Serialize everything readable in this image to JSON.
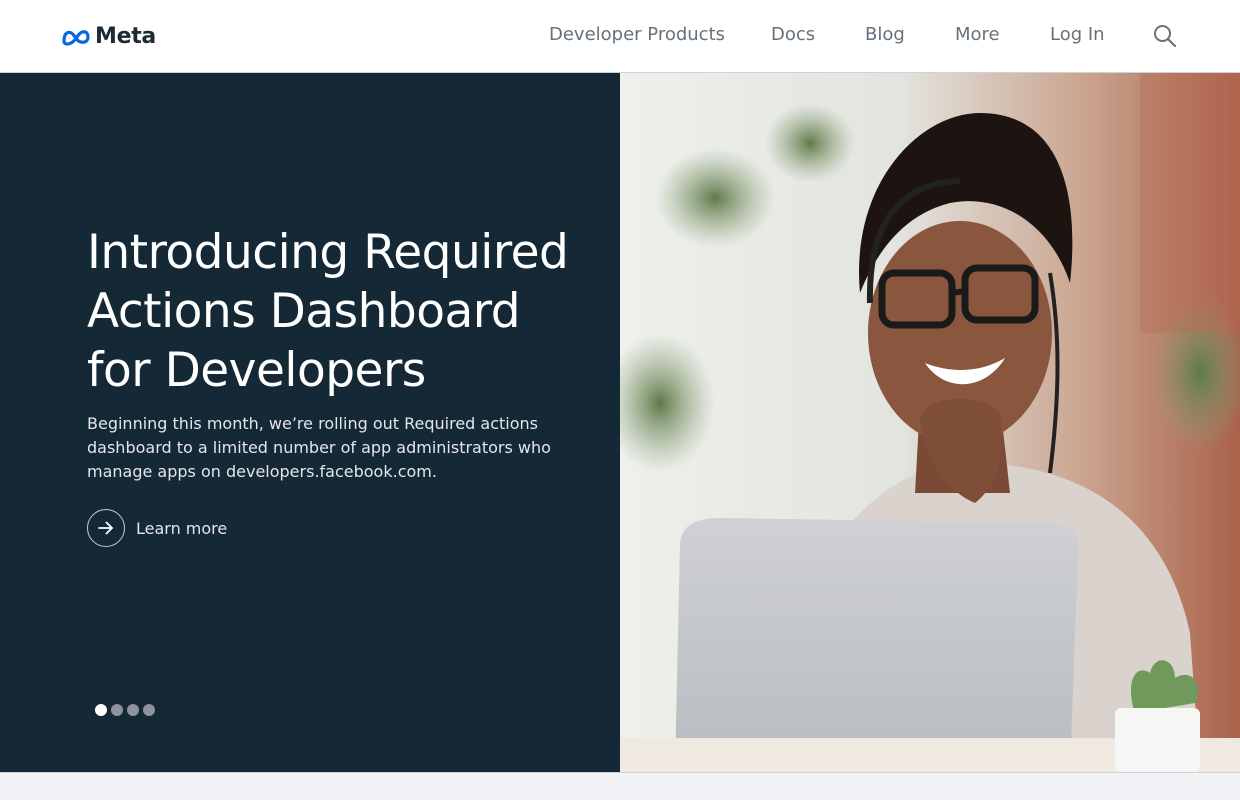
{
  "header": {
    "logo_text": "Meta",
    "nav": {
      "developer_products": "Developer Products",
      "docs": "Docs",
      "blog": "Blog",
      "more": "More",
      "log_in": "Log In"
    },
    "search_icon": "search-icon"
  },
  "hero": {
    "title": "Introducing Required Actions Dashboard for Developers",
    "description": "Beginning this month, we’re rolling out Required actions dashboard to a limited number of app administrators who manage apps on developers.facebook.com.",
    "learn_more_label": "Learn more",
    "learn_more_icon": "arrow-right-icon",
    "carousel": {
      "slide_count": 4,
      "active_slide": 1
    },
    "photo_description": ""
  },
  "colors": {
    "hero_background": "#142835",
    "header_background": "#ffffff",
    "nav_text": "#65727c",
    "brand_blue": "#0668e1"
  }
}
